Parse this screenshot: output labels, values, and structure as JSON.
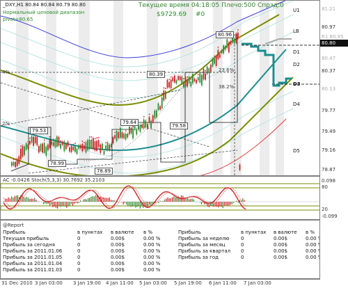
{
  "main": {
    "symbol_line": "_DXY,H1  80.84 80.84 80.79 80.80",
    "ind_line1": "Нормальный ценовой диапазон",
    "ind_line2": "pivot=80.65",
    "status_line": "Текущее время 04:18:05 Плечо:500 Спрэд:0",
    "balance": "$9729.69",
    "hash": "#0",
    "boxes": [
      "80.96",
      "80.39",
      "79.64",
      "79.53",
      "79.58",
      "78.99",
      "78.89"
    ],
    "pct_labels": [
      "4%",
      "2%",
      "23.6%",
      "38.2%"
    ],
    "levels": [
      "U1",
      "LB",
      "D1",
      "D2",
      "D3",
      "D4",
      "D5"
    ],
    "price_ticks": [
      "81.22",
      "80.97",
      "80.72",
      "80.47",
      "80.22",
      "79.97",
      "79.72",
      "79.47",
      "79.22",
      "78.97"
    ],
    "right_labels": [
      "81.21",
      "80.97",
      "R1 80.95",
      "80.80",
      "80.47",
      "80.37",
      "80.13",
      "79.77",
      "79.49",
      "79.16",
      "78.87"
    ],
    "current_price": "80.80"
  },
  "ind": {
    "label": "AC -0.0426  Stoch(5,3,3) 30.7692 35.2103",
    "ticks": [
      "80",
      "20",
      "0.098",
      "-0.099"
    ]
  },
  "report": {
    "title": "@Report",
    "headers": [
      "Прибыль",
      "в пунктах",
      "в валюте",
      "в %",
      "Прибыль",
      "в пунктах",
      "в валюте",
      "в %"
    ],
    "left": [
      [
        "Текущая прибыль",
        "0",
        "0.00$",
        "0.00 %"
      ],
      [
        "Прибыль за сегодня",
        "0",
        "0.00$",
        "0.00 %"
      ],
      [
        "Прибыль за 2011.01.06",
        "0",
        "0.00$",
        "0.00 %"
      ],
      [
        "Прибыль за 2011.01.05",
        "0",
        "0.00$",
        "0.00 %"
      ],
      [
        "Прибыль за 2011.01.04",
        "0",
        "0.00$",
        "0.00 %"
      ],
      [
        "Прибыль за 2011.01.03",
        "0",
        "0.00$",
        "0.00 %"
      ]
    ],
    "right": [
      [
        "Прибыль за неделю",
        "0",
        "0.00$",
        "0.00 %"
      ],
      [
        "Прибыль за месяц",
        "0",
        "0.00$",
        "0.00 %"
      ],
      [
        "Прибыль за квартал",
        "0",
        "0.00$",
        "0.00 %"
      ],
      [
        "Прибыль за год",
        "0",
        "0.00$",
        "0.00 %"
      ]
    ]
  },
  "time_axis": [
    "31 Dec 2010",
    "3 Jan 03:00",
    "3 Jan 19:00",
    "4 Jan 11:00",
    "5 Jan 03:00",
    "5 Jan 19:00",
    "6 Jan 11:00",
    "7 Jan 03:00"
  ],
  "colors": {
    "bull": "#2e8b2e",
    "bear": "#cc2222",
    "envelope": "#7a8c00",
    "mid": "#1a8c8c",
    "upper": "#3a3ae0",
    "lower": "#e03a3a"
  }
}
